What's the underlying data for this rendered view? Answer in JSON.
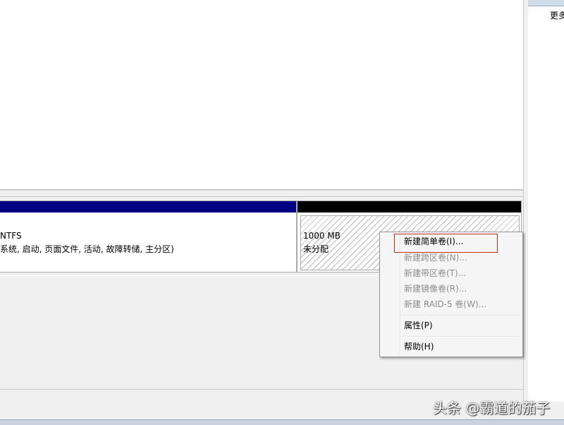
{
  "right_pane": {
    "more_label": "更多"
  },
  "disk": {
    "partition1": {
      "filesystem": "NTFS",
      "status": "系统, 启动, 页面文件, 活动, 故障转储, 主分区)",
      "bar_color": "#000080"
    },
    "partition2": {
      "size": "1000 MB",
      "status": "未分配",
      "bar_color": "#000000"
    }
  },
  "context_menu": {
    "new_simple_volume": "新建简单卷(I)...",
    "new_spanned_volume": "新建跨区卷(N)...",
    "new_striped_volume": "新建带区卷(T)...",
    "new_mirrored_volume": "新建镜像卷(R)...",
    "new_raid5_volume": "新建 RAID-5 卷(W)...",
    "properties": "属性(P)",
    "help": "帮助(H)"
  },
  "watermark": "头条 @霸道的茄子",
  "colors": {
    "highlight_box": "#c42b1c",
    "unallocated_bar": "#000000",
    "primary_bar": "#000080"
  }
}
